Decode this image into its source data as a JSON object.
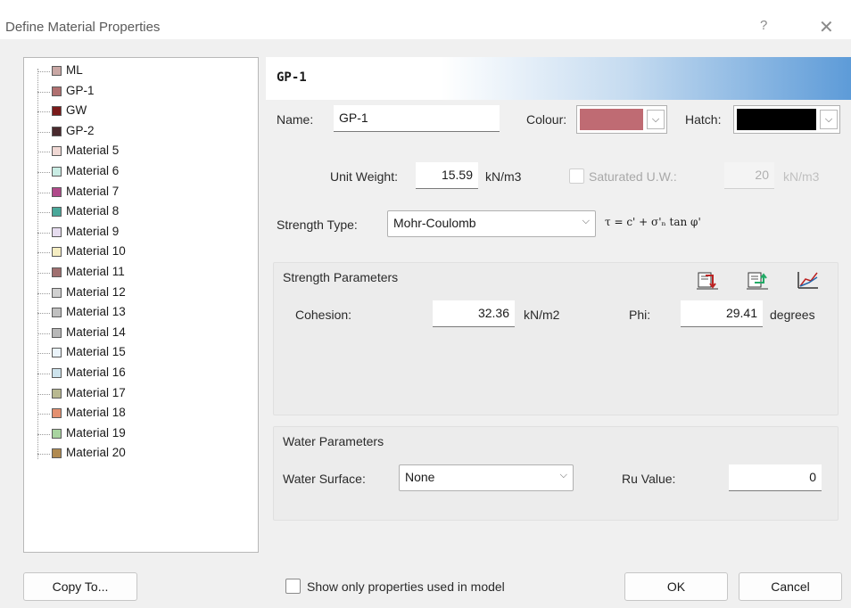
{
  "window": {
    "title": "Define Material Properties",
    "help": "?",
    "close": "✕"
  },
  "materials": [
    {
      "label": "ML",
      "color": "#c9a7a4"
    },
    {
      "label": "GP-1",
      "color": "#b07070"
    },
    {
      "label": "GW",
      "color": "#7a1a1a"
    },
    {
      "label": "GP-2",
      "color": "#4a2a2e"
    },
    {
      "label": "Material 5",
      "color": "#f0d8d4"
    },
    {
      "label": "Material 6",
      "color": "#c9ece4"
    },
    {
      "label": "Material 7",
      "color": "#b04a8a"
    },
    {
      "label": "Material 8",
      "color": "#4aa89a"
    },
    {
      "label": "Material 9",
      "color": "#e6dcef"
    },
    {
      "label": "Material 10",
      "color": "#f5edc2"
    },
    {
      "label": "Material 11",
      "color": "#a07070"
    },
    {
      "label": "Material 12",
      "color": "#d0d0d0"
    },
    {
      "label": "Material 13",
      "color": "#c0c0c0"
    },
    {
      "label": "Material 14",
      "color": "#b8b8b8"
    },
    {
      "label": "Material 15",
      "color": "#eaf3fa"
    },
    {
      "label": "Material 16",
      "color": "#cde3ec"
    },
    {
      "label": "Material 17",
      "color": "#b8b890"
    },
    {
      "label": "Material 18",
      "color": "#e49070"
    },
    {
      "label": "Material 19",
      "color": "#a8d4a0"
    },
    {
      "label": "Material 20",
      "color": "#b08a50"
    }
  ],
  "copy_to": "Copy To...",
  "selected": {
    "header": "GP-1",
    "name_label": "Name:",
    "name_value": "GP-1",
    "colour_label": "Colour:",
    "colour_value": "#bf6b73",
    "hatch_label": "Hatch:",
    "hatch_value": "#000000"
  },
  "unit_weight": {
    "label": "Unit Weight:",
    "value": "15.59",
    "unit": "kN/m3",
    "saturated_label": "Saturated U.W.:",
    "saturated_value": "20",
    "saturated_unit": "kN/m3"
  },
  "strength_type": {
    "label": "Strength Type:",
    "value": "Mohr-Coulomb",
    "formula": "τ = c' + σ'ₙ tan φ'"
  },
  "strength_params": {
    "title": "Strength Parameters",
    "cohesion_label": "Cohesion:",
    "cohesion_value": "32.36",
    "cohesion_unit": "kN/m2",
    "phi_label": "Phi:",
    "phi_value": "29.41",
    "phi_unit": "degrees",
    "tool_icons": [
      "import-icon",
      "export-icon",
      "chart-icon"
    ]
  },
  "water_params": {
    "title": "Water Parameters",
    "surface_label": "Water Surface:",
    "surface_value": "None",
    "ru_label": "Ru Value:",
    "ru_value": "0"
  },
  "footer": {
    "show_only_label": "Show only properties used in model",
    "ok": "OK",
    "cancel": "Cancel"
  }
}
